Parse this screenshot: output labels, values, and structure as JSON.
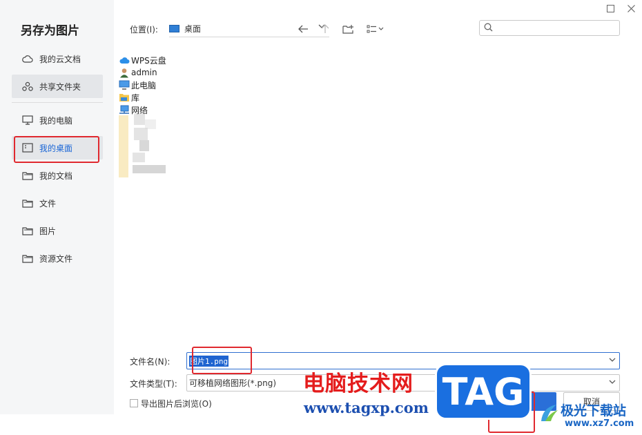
{
  "dialog": {
    "title": "另存为图片"
  },
  "sidebar": {
    "items": [
      {
        "label": "我的云文档",
        "icon": "cloud-icon"
      },
      {
        "label": "共享文件夹",
        "icon": "share-icon"
      },
      {
        "label": "我的电脑",
        "icon": "monitor-icon"
      },
      {
        "label": "我的桌面",
        "icon": "desktop-icon"
      },
      {
        "label": "我的文档",
        "icon": "folder-icon"
      },
      {
        "label": "文件",
        "icon": "folder-icon"
      },
      {
        "label": "图片",
        "icon": "folder-icon"
      },
      {
        "label": "资源文件",
        "icon": "folder-icon"
      }
    ]
  },
  "toolbar": {
    "location_label": "位置(I):",
    "location_value": "桌面",
    "search_placeholder": ""
  },
  "files": [
    {
      "name": "WPS云盘",
      "icon": "cloud-drive-icon"
    },
    {
      "name": "admin",
      "icon": "user-icon"
    },
    {
      "name": "此电脑",
      "icon": "computer-icon"
    },
    {
      "name": "库",
      "icon": "library-icon"
    },
    {
      "name": "网络",
      "icon": "network-icon"
    }
  ],
  "form": {
    "filename_label": "文件名(N):",
    "filename_first_char": "图",
    "filename_rest": "片1.png",
    "filetype_label": "文件类型(T):",
    "filetype_value": "可移植网络图形(*.png)",
    "checkbox_label": "导出图片后浏览(O)",
    "save_label": "",
    "cancel_label": "取消"
  },
  "watermark": {
    "text": "电脑技术网",
    "url": "www.tagxp.com",
    "tag": "TAG",
    "site_cn": "极光下载站",
    "site_en": "www.xz7.com"
  },
  "colors": {
    "accent": "#2a6fd8",
    "highlight": "#e0282e",
    "sidebar_bg": "#f5f6f7"
  }
}
